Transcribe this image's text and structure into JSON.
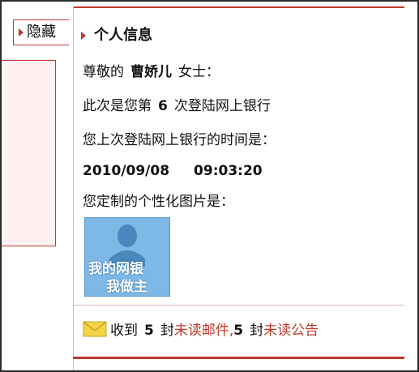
{
  "sidebar": {
    "hide_label": "隐藏"
  },
  "panel": {
    "title": "个人信息"
  },
  "greeting": {
    "prefix": "尊敬的",
    "name": "曹娇儿",
    "suffix": "女士："
  },
  "login_count": {
    "prefix": "此次是您第",
    "count": "6",
    "suffix": "次登陆网上银行"
  },
  "last_login": {
    "label": "您上次登陆网上银行的时间是：",
    "date": "2010/09/08",
    "time": "09:03:20"
  },
  "custom_image": {
    "label": "您定制的个性化图片是：",
    "caption_line1": "我的网银",
    "caption_line2": "我做主"
  },
  "mail": {
    "received_label": "收到",
    "unread_mail_count": "5",
    "unit1": "封",
    "unread_mail_link": "未读邮件,",
    "unread_notice_count": "5",
    "unit2": "封",
    "unread_notice_link": "未读公告"
  },
  "colors": {
    "accent": "#c0392b",
    "avatar_bg": "#7eb8e6",
    "envelope": "#f3d34a"
  },
  "icons": {
    "hide": "triangle-right-icon",
    "title": "triangle-right-icon",
    "mail": "envelope-icon"
  }
}
